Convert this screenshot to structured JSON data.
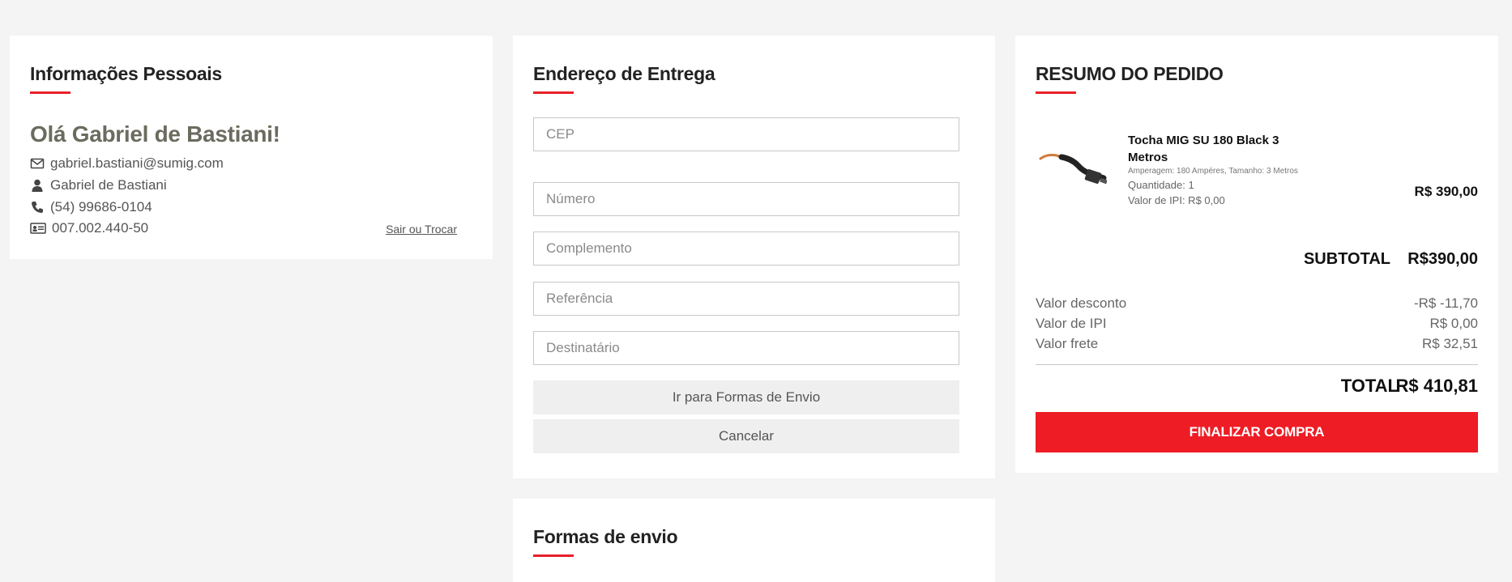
{
  "personal": {
    "title": "Informações Pessoais",
    "greeting": "Olá Gabriel de Bastiani!",
    "email": "gabriel.bastiani@sumig.com",
    "name": "Gabriel de Bastiani",
    "phone": "(54) 99686-0104",
    "document": "007.002.440-50",
    "logout_link": "Sair ou Trocar"
  },
  "address": {
    "title": "Endereço de Entrega",
    "fields": {
      "cep": "CEP",
      "numero": "Número",
      "complemento": "Complemento",
      "referencia": "Referência",
      "destinatario": "Destinatário"
    },
    "next_button": "Ir para Formas de Envio",
    "cancel_button": "Cancelar"
  },
  "shipping": {
    "title": "Formas de envio"
  },
  "summary": {
    "title": "RESUMO DO PEDIDO",
    "product": {
      "name": "Tocha MIG SU 180 Black 3 Metros",
      "spec": "Amperagem: 180 Ampéres, Tamanho: 3 Metros",
      "quantity": "Quantidade: 1",
      "ipi": "Valor de IPI: R$ 0,00",
      "price": "R$ 390,00",
      "image_icon": "mig-torch-image"
    },
    "subtotal_label": "SUBTOTAL",
    "subtotal_value": "R$390,00",
    "rows": [
      {
        "label": "Valor desconto",
        "value": "-R$ -11,70"
      },
      {
        "label": "Valor de IPI",
        "value": "R$ 0,00"
      },
      {
        "label": "Valor frete",
        "value": "R$ 32,51"
      }
    ],
    "total_label": "TOTAL",
    "total_value": "R$ 410,81",
    "finalize_button": "FINALIZAR COMPRA"
  },
  "colors": {
    "accent": "#ee1c25",
    "background": "#f4f4f4",
    "greeting": "#6b6b5f"
  }
}
